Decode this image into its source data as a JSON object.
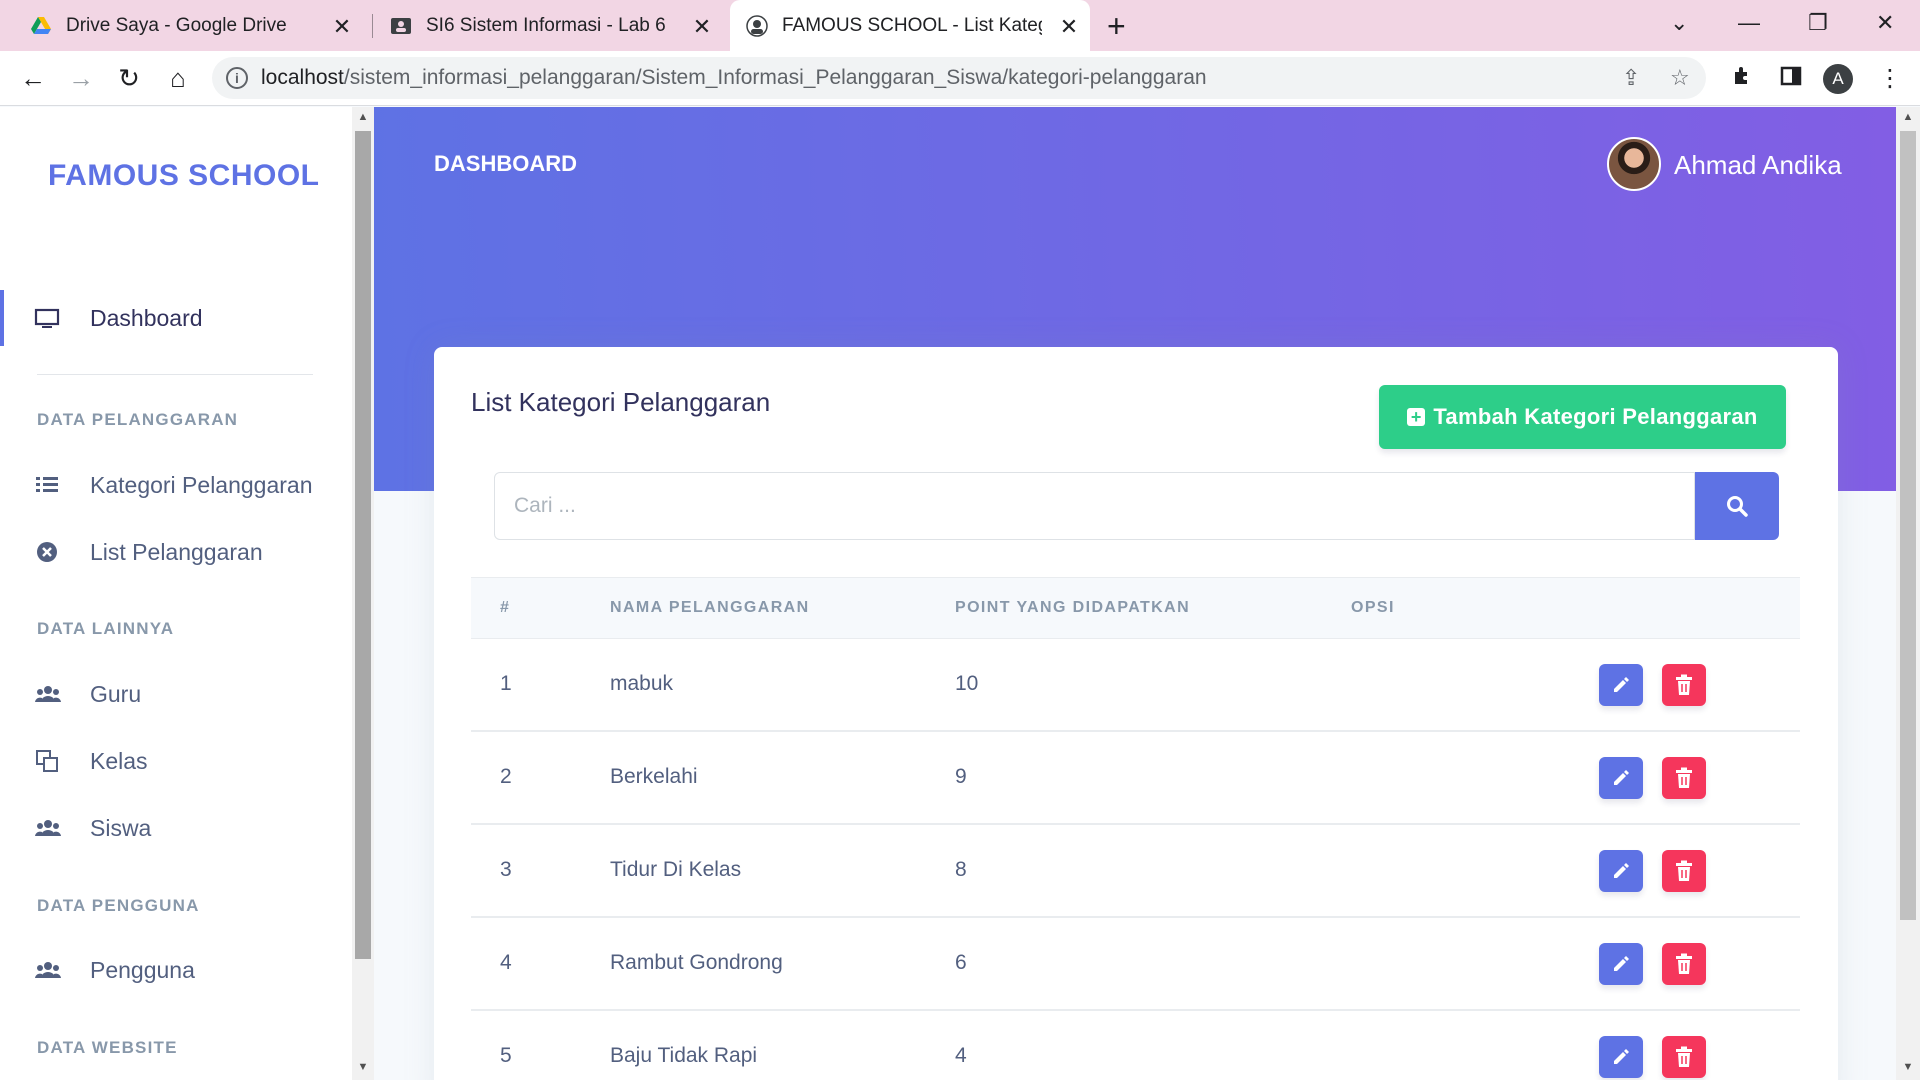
{
  "browser": {
    "tabs": [
      {
        "title": "Drive Saya - Google Drive",
        "icon": "google-drive-icon"
      },
      {
        "title": "SI6 Sistem Informasi - Lab 6",
        "icon": "classroom-icon"
      },
      {
        "title": "FAMOUS SCHOOL - List Kategori",
        "icon": "page-favicon-icon"
      }
    ],
    "url_host": "localhost",
    "url_path": "/sistem_informasi_pelanggaran/Sistem_Informasi_Pelanggaran_Siswa/kategori-pelanggaran",
    "profile_initial": "A"
  },
  "sidebar": {
    "brand": "FAMOUS SCHOOL",
    "dashboard": "Dashboard",
    "section_pelanggaran": "DATA PELANGGARAN",
    "kategori": "Kategori Pelanggaran",
    "list_pelanggaran": "List Pelanggaran",
    "section_lainnya": "DATA LAINNYA",
    "guru": "Guru",
    "kelas": "Kelas",
    "siswa": "Siswa",
    "section_pengguna": "DATA PENGGUNA",
    "pengguna": "Pengguna",
    "section_website": "DATA WEBSITE"
  },
  "header": {
    "title": "DASHBOARD",
    "user_name": "Ahmad Andika"
  },
  "card": {
    "title": "List Kategori Pelanggaran",
    "add_button": "Tambah Kategori Pelanggaran",
    "search_placeholder": "Cari ...",
    "columns": [
      "#",
      "NAMA PELANGGARAN",
      "POINT YANG DIDAPATKAN",
      "OPSI"
    ],
    "rows": [
      {
        "no": "1",
        "nama": "mabuk",
        "point": "10"
      },
      {
        "no": "2",
        "nama": "Berkelahi",
        "point": "9"
      },
      {
        "no": "3",
        "nama": "Tidur Di Kelas",
        "point": "8"
      },
      {
        "no": "4",
        "nama": "Rambut Gondrong",
        "point": "6"
      },
      {
        "no": "5",
        "nama": "Baju Tidak Rapi",
        "point": "4"
      }
    ]
  },
  "colors": {
    "primary": "#5e72e4",
    "success": "#2dce89",
    "danger": "#f5365c",
    "tab_strip": "#f2d6e4"
  }
}
